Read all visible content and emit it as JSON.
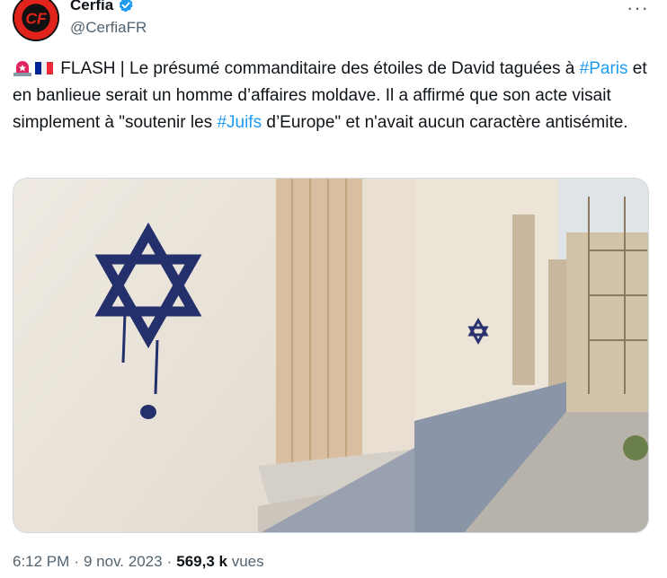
{
  "author": {
    "display_name": "Cerfia",
    "handle": "@CerfiaFR",
    "avatar_text": "CF",
    "verified": true
  },
  "more_label": "···",
  "tweet": {
    "prefix": "FLASH | Le présumé commanditaire des étoiles de David taguées à ",
    "hashtag_1": "#Paris",
    "middle": " et en banlieue serait un homme d’affaires moldave. Il a affirmé que son acte visait simplement à \"soutenir les ",
    "hashtag_2": "#Juifs",
    "suffix": " d’Europe\" et n'avait aucun caractère antisémite.",
    "emojis": [
      "rotating-light-emoji",
      "france-flag-emoji"
    ]
  },
  "media": {
    "icon": "photo-of-wall-with-star-of-david-graffiti"
  },
  "meta": {
    "time": "6:12 PM",
    "date": "9 nov. 2023",
    "views_count": "569,3 k",
    "views_label": "vues"
  },
  "colors": {
    "link": "#1d9bf0",
    "secondary_text": "#536471",
    "verified": "#1d9bf0",
    "avatar_bg": "#e1241b"
  }
}
